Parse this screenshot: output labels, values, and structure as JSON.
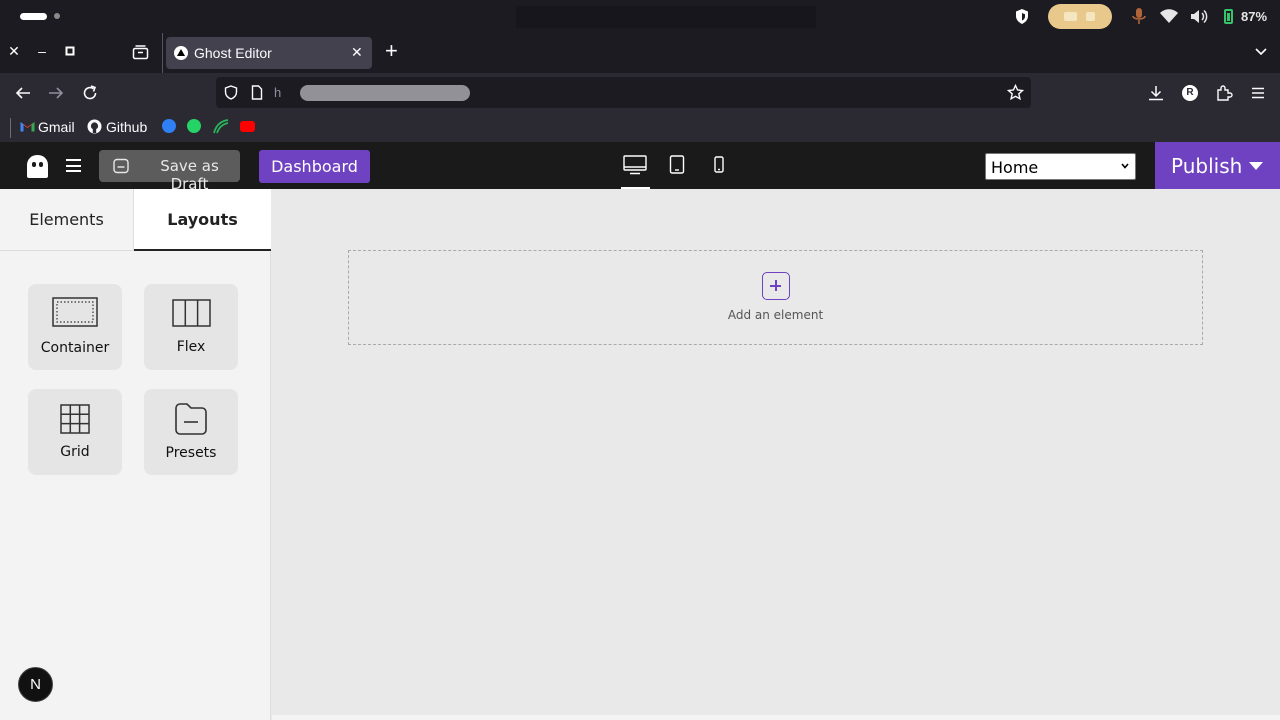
{
  "os": {
    "battery_percent": "87%"
  },
  "browser": {
    "tab_title": "Ghost Editor",
    "url_prefix": "h",
    "bookmarks": [
      {
        "label": "Gmail"
      },
      {
        "label": "Github"
      }
    ]
  },
  "toolbar": {
    "save_draft_label": "Save as Draft",
    "dashboard_label": "Dashboard",
    "page_select_value": "Home",
    "publish_label": "Publish"
  },
  "sidebar": {
    "tabs": [
      {
        "label": "Elements",
        "active": false
      },
      {
        "label": "Layouts",
        "active": true
      }
    ],
    "layouts": [
      {
        "label": "Container",
        "icon": "container-icon"
      },
      {
        "label": "Flex",
        "icon": "flex-icon"
      },
      {
        "label": "Grid",
        "icon": "grid-icon"
      },
      {
        "label": "Presets",
        "icon": "presets-icon"
      }
    ]
  },
  "canvas": {
    "add_element_label": "Add an element"
  },
  "badge": {
    "letter": "N"
  },
  "colors": {
    "accent": "#6f42c1",
    "app_toolbar": "#1a1a1a",
    "browser_chrome": "#2b2a33"
  }
}
